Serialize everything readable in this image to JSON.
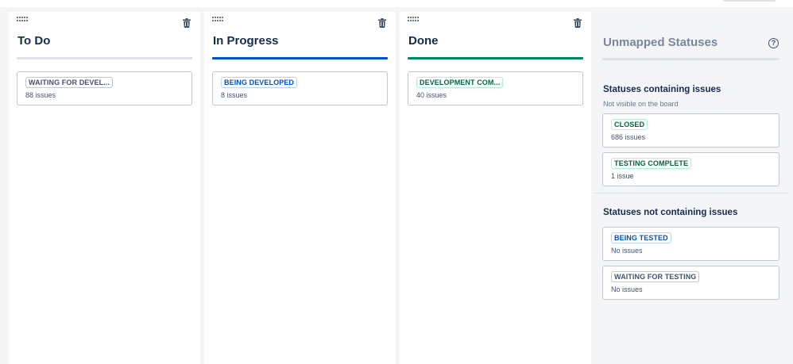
{
  "columns": [
    {
      "title": "To Do",
      "status": {
        "label": "WAITING FOR DEVEL...",
        "count": "88 issues"
      }
    },
    {
      "title": "In Progress",
      "status": {
        "label": "BEING DEVELOPED",
        "count": "8 issues"
      }
    },
    {
      "title": "Done",
      "status": {
        "label": "DEVELOPMENT COM...",
        "count": "40 issues"
      }
    }
  ],
  "unmapped": {
    "title": "Unmapped Statuses",
    "help_glyph": "?",
    "with_issues": {
      "heading": "Statuses containing issues",
      "subtext": "Not visible on the board",
      "items": [
        {
          "label": "CLOSED",
          "count": "686 issues"
        },
        {
          "label": "TESTING COMPLETE",
          "count": "1 issue"
        }
      ]
    },
    "without_issues": {
      "heading": "Statuses not containing issues",
      "items": [
        {
          "label": "BEING TESTED",
          "count": "No issues"
        },
        {
          "label": "WAITING FOR TESTING",
          "count": "No issues"
        }
      ]
    }
  },
  "colors": {
    "todo_bar": "#dfe1e6",
    "in_progress_bar": "#0052cc",
    "done_bar": "#00875a",
    "lozenge_blue": "#0052cc",
    "lozenge_green": "#006644",
    "lozenge_grey": "#42526e"
  },
  "icons": {
    "column_drag": "drag-handle-icon",
    "column_delete": "trash-icon",
    "help": "question-circle-icon"
  }
}
